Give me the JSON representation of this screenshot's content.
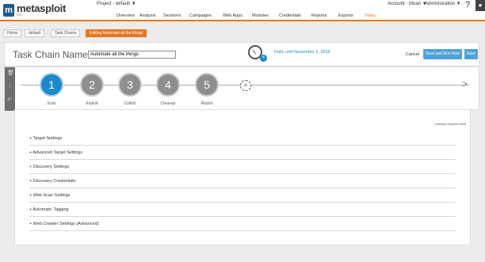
{
  "app": {
    "logo_text": "metasploit",
    "logo_sub": "pro",
    "logo_mark": "m",
    "project_label": "Project - default ▼",
    "account_label": "Account - tdoan ▼",
    "admin_label": "Administration ▼",
    "help_label": "?",
    "user_icon": "user-icon"
  },
  "nav": [
    {
      "label": "Overview"
    },
    {
      "label": "Analysis"
    },
    {
      "label": "Sessions"
    },
    {
      "label": "Campaigns"
    },
    {
      "label": "Web Apps"
    },
    {
      "label": "Modules"
    },
    {
      "label": "Credentials"
    },
    {
      "label": "Reports"
    },
    {
      "label": "Exports"
    },
    {
      "label": "Tasks",
      "active": true
    }
  ],
  "breadcrumb": [
    "Home",
    "default",
    "Task Chains",
    "Editing Automate all the things"
  ],
  "chain": {
    "title": "Task Chain Name:",
    "name_value": "Automate all the things",
    "schedule": "Daily until November 2, 2016",
    "cancel_label": "Cancel",
    "run_label": "Save and Run Now",
    "save_label": "Save"
  },
  "steps": [
    {
      "num": "1",
      "label": "Scan",
      "active": true
    },
    {
      "num": "2",
      "label": "Exploit"
    },
    {
      "num": "3",
      "label": "Collect"
    },
    {
      "num": "4",
      "label": "Cleanup"
    },
    {
      "num": "5",
      "label": "Report"
    }
  ],
  "add_step_label": "+",
  "side_tools": [
    "trash-icon",
    "grip-icon",
    "undo-icon"
  ],
  "panel": {
    "required_note": "* denotes required field",
    "settings": [
      "+ Target Settings",
      "+ Advanced Target Settings",
      "+ Discovery Settings",
      "+ Discovery Credentials",
      "+ Web Scan Settings",
      "+ Automatic Tagging",
      "+ Web Crawler Settings (Advanced)"
    ]
  },
  "colors": {
    "accent": "#e87722",
    "blue": "#1e88c8",
    "button": "#4da3d9"
  }
}
